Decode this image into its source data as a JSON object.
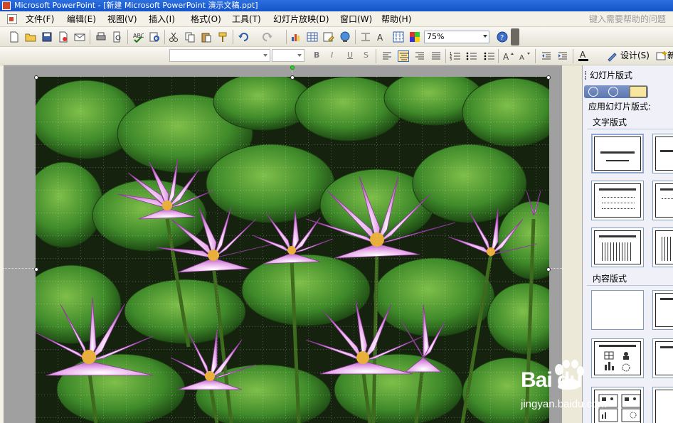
{
  "window": {
    "title": "Microsoft PowerPoint - [新建 Microsoft PowerPoint 演示文稿.ppt]"
  },
  "menu": {
    "items": [
      "文件(F)",
      "编辑(E)",
      "视图(V)",
      "插入(I)",
      "格式(O)",
      "工具(T)",
      "幻灯片放映(D)",
      "窗口(W)",
      "帮助(H)"
    ],
    "help_placeholder": "键入需要帮助的问题"
  },
  "toolbar": {
    "zoom": "75%",
    "design_label": "设计(S)",
    "new_slide_label": "新",
    "format_buttons": [
      "B",
      "I",
      "U",
      "S"
    ]
  },
  "task_pane": {
    "title": "幻灯片版式",
    "apply_label": "应用幻灯片版式:",
    "sections": {
      "text_layouts": "文字版式",
      "content_layouts": "内容版式"
    }
  },
  "watermark": {
    "brand": "Bai du",
    "sub": "jingyan.baidu.com"
  },
  "colors": {
    "title_bar": "#1454C8",
    "accent_blue": "#316AC5",
    "lily_pink": "#C96BD0",
    "leaf_green": "#3F8A2A"
  }
}
